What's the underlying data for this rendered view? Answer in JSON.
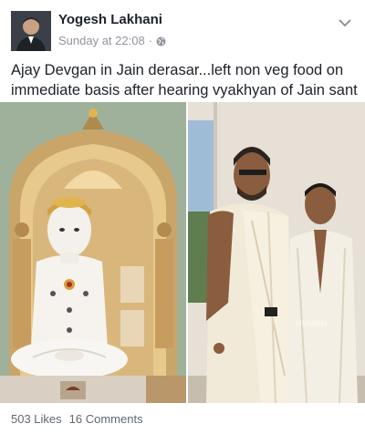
{
  "post": {
    "author": "Yogesh Lakhani",
    "timestamp": "Sunday at 22:08",
    "separator": "·",
    "privacy_icon": "globe-icon",
    "menu_icon": "chevron-down-icon",
    "caption": "Ajay Devgan in Jain derasar...left non veg food on immediate basis after hearing vyakhyan of Jain sant"
  },
  "photos": {
    "left": "jain-idol-photo",
    "right": "two-men-photo",
    "watermark": "HMMNN"
  },
  "footer": {
    "likes": "503 Likes",
    "comments": "16 Comments"
  },
  "colors": {
    "text": "#1d2129",
    "meta": "#90949c",
    "footer": "#606770"
  }
}
